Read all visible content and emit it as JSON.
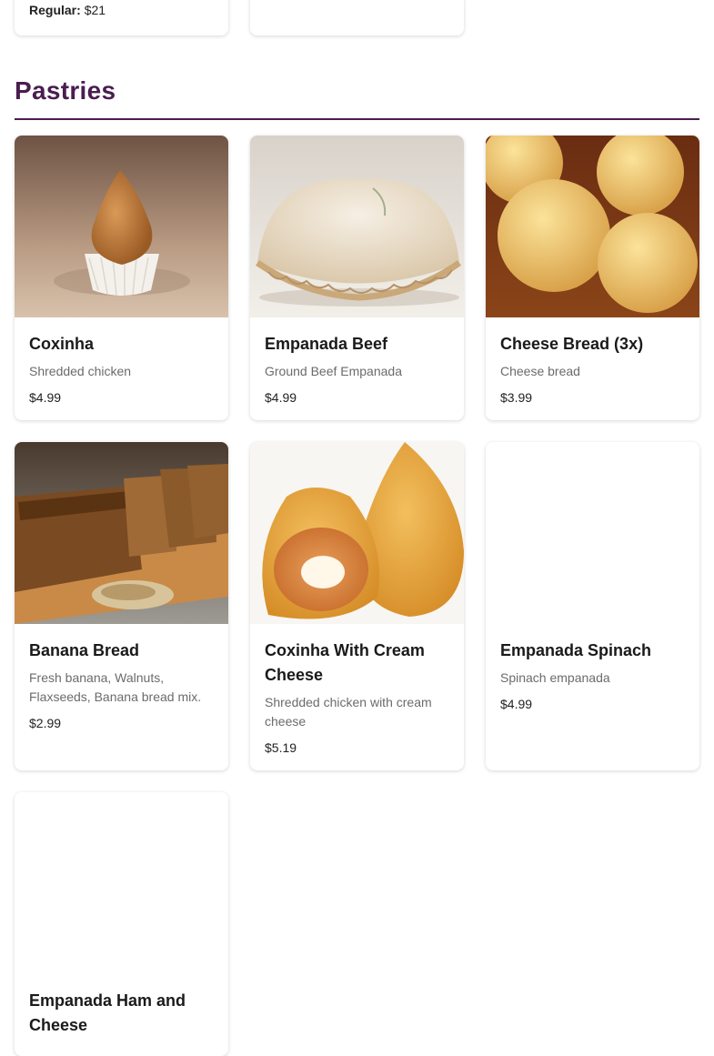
{
  "prev": {
    "regular_label": "Regular:",
    "regular_price": "$21"
  },
  "section": {
    "title": "Pastries"
  },
  "items": [
    {
      "title": "Coxinha",
      "desc": "Shredded chicken",
      "price": "$4.99"
    },
    {
      "title": "Empanada Beef",
      "desc": "Ground Beef Empanada",
      "price": "$4.99"
    },
    {
      "title": "Cheese Bread (3x)",
      "desc": "Cheese bread",
      "price": "$3.99"
    },
    {
      "title": "Banana Bread",
      "desc": "Fresh banana, Walnuts, Flaxseeds, Banana bread mix.",
      "price": "$2.99"
    },
    {
      "title": "Coxinha With Cream Cheese",
      "desc": "Shredded chicken with cream cheese",
      "price": "$5.19"
    },
    {
      "title": "Empanada Spinach",
      "desc": "Spinach empanada",
      "price": "$4.99"
    },
    {
      "title": "Empanada Ham and Cheese",
      "desc": "",
      "price": ""
    }
  ],
  "colors": {
    "section_title": "#4a1d4f",
    "price_text": "#222222",
    "desc_text": "#6b6b6b"
  }
}
